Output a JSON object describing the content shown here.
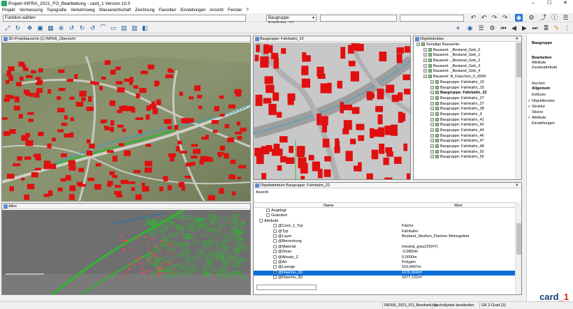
{
  "window": {
    "title": "Projekt INFRA_2021_FO_Bearbeitung - card_1 Version 10.0",
    "min": "–",
    "max": "☐",
    "close": "✕"
  },
  "menu": [
    "Projekt",
    "Vermessung",
    "Topografie",
    "Verkehrsweg",
    "Wasserwirtschaft",
    "Zeichnung",
    "Favoriten",
    "Einstellungen",
    "Ansicht",
    "Fenster",
    "?"
  ],
  "toolbar": {
    "function_combo": "Funktion wählen",
    "group_combo": "Baugruppe: Fahrbahn_22"
  },
  "panes": {
    "view3d": {
      "title": "3D-Projektansicht (1) INFRA_Übersicht"
    },
    "detail": {
      "title": "Baugruppe: Fahrbahn_22"
    },
    "overview": {
      "title": "Alles"
    },
    "objstruct": {
      "title": "Objektstruktur"
    },
    "attributes": {
      "title": "Objektattribute Baugruppe: Fahrbahn_22",
      "toolbar_label": "Ansicht",
      "col_name": "Name",
      "col_value": "Wert"
    }
  },
  "tree": [
    {
      "label": "Sonstige Bauwerke",
      "level": 0,
      "bold": false
    },
    {
      "label": "Bauwerk: _Bestand_Geb_0",
      "level": 1,
      "bold": false
    },
    {
      "label": "Bauwerk: _Bestand_Geb_1",
      "level": 1,
      "bold": false
    },
    {
      "label": "Bauwerk: _Bestand_Geb_2",
      "level": 1,
      "bold": false
    },
    {
      "label": "Bauwerk: _Bestand_Geb_3",
      "level": 1,
      "bold": false
    },
    {
      "label": "Bauwerk: _Bestand_Geb_4",
      "level": 1,
      "bold": false
    },
    {
      "label": "Bauwerk: B_Flaechen_0_9999",
      "level": 1,
      "bold": false
    },
    {
      "label": "Baugruppe: Fahrbahn_10",
      "level": 2,
      "bold": false
    },
    {
      "label": "Baugruppe: Fahrbahn_15",
      "level": 2,
      "bold": false
    },
    {
      "label": "Baugruppe: Fahrbahn_22",
      "level": 2,
      "bold": true
    },
    {
      "label": "Baugruppe: Fahrbahn_27",
      "level": 2,
      "bold": false
    },
    {
      "label": "Baugruppe: Fahrbahn_37",
      "level": 2,
      "bold": false
    },
    {
      "label": "Baugruppe: Fahrbahn_38",
      "level": 2,
      "bold": false
    },
    {
      "label": "Baugruppe: Fahrbahn_4",
      "level": 2,
      "bold": false
    },
    {
      "label": "Baugruppe: Fahrbahn_41",
      "level": 2,
      "bold": false
    },
    {
      "label": "Baugruppe: Fahrbahn_42",
      "level": 2,
      "bold": false
    },
    {
      "label": "Baugruppe: Fahrbahn_44",
      "level": 2,
      "bold": false
    },
    {
      "label": "Baugruppe: Fahrbahn_46",
      "level": 2,
      "bold": false
    },
    {
      "label": "Baugruppe: Fahrbahn_47",
      "level": 2,
      "bold": false
    },
    {
      "label": "Baugruppe: Fahrbahn_48",
      "level": 2,
      "bold": false
    },
    {
      "label": "Baugruppe: Fahrbahn_50",
      "level": 2,
      "bold": false
    },
    {
      "label": "Baugruppe: Fahrbahn_55",
      "level": 2,
      "bold": false
    }
  ],
  "attributes": [
    {
      "name": "Angelegt",
      "value": "",
      "level": 1,
      "sel": false
    },
    {
      "name": "Geändert",
      "value": "",
      "level": 1,
      "sel": false
    },
    {
      "name": "Attribute",
      "value": "",
      "level": 0,
      "sel": false
    },
    {
      "name": "@Card_1_Typ",
      "value": "Fläche",
      "level": 2,
      "sel": false
    },
    {
      "name": "@Typ",
      "value": "Fahrbahn",
      "level": 2,
      "sel": false
    },
    {
      "name": "@Layer",
      "value": "Bestand_Straßen_Flächen  Wohngebiet",
      "level": 2,
      "sel": false
    },
    {
      "name": "@Bemerkung",
      "value": "",
      "level": 2,
      "sel": false
    },
    {
      "name": "@Material",
      "value": "Ineutral_grau220(#7)",
      "level": 2,
      "sel": false
    },
    {
      "name": "@Dicke",
      "value": "-0,0800m",
      "level": 2,
      "sel": false
    },
    {
      "name": "@Absatz_Z",
      "value": "0,0000m",
      "level": 2,
      "sel": false
    },
    {
      "name": "@Art",
      "value": "Polygon",
      "level": 2,
      "sel": false
    },
    {
      "name": "@Laenge",
      "value": "510,6407m",
      "level": 2,
      "sel": false
    },
    {
      "name": "@Flaeche_2D",
      "value": "1676,664m²",
      "level": 2,
      "sel": true
    },
    {
      "name": "@Flaeche_3D",
      "value": "1677,131m²",
      "level": 2,
      "sel": false
    }
  ],
  "rpanel": {
    "header": "Baugruppe",
    "items": [
      {
        "label": "Bearbeiten",
        "bold": true,
        "check": false
      },
      {
        "label": "Attribute",
        "bold": false,
        "check": false
      },
      {
        "label": "Zusatzattribute",
        "bold": false,
        "check": false
      },
      {
        "label": "löschen",
        "bold": false,
        "check": false
      },
      {
        "label": "Allgemein",
        "bold": true,
        "check": false
      },
      {
        "label": "Exklusiv",
        "bold": false,
        "check": false
      },
      {
        "label": "Objektfenster",
        "bold": false,
        "check": true
      },
      {
        "label": "Struktur",
        "bold": false,
        "check": true
      },
      {
        "label": "Skizze",
        "bold": false,
        "check": false
      },
      {
        "label": "Attribute",
        "bold": false,
        "check": true
      },
      {
        "label": "Einstellungen",
        "bold": false,
        "check": false
      }
    ]
  },
  "status": {
    "project": "INFRA_2021_FO_Bearbeitung",
    "mode": "Fachobjekte bearbeiten",
    "crs": "GK 3 Grad (3)"
  },
  "logo": {
    "text": "card",
    "mark": "_1"
  },
  "colors": {
    "building": "#e01010",
    "street": "#c8c8c8",
    "alignment": "#1aa7d8",
    "selection": "#0a6fd6"
  }
}
